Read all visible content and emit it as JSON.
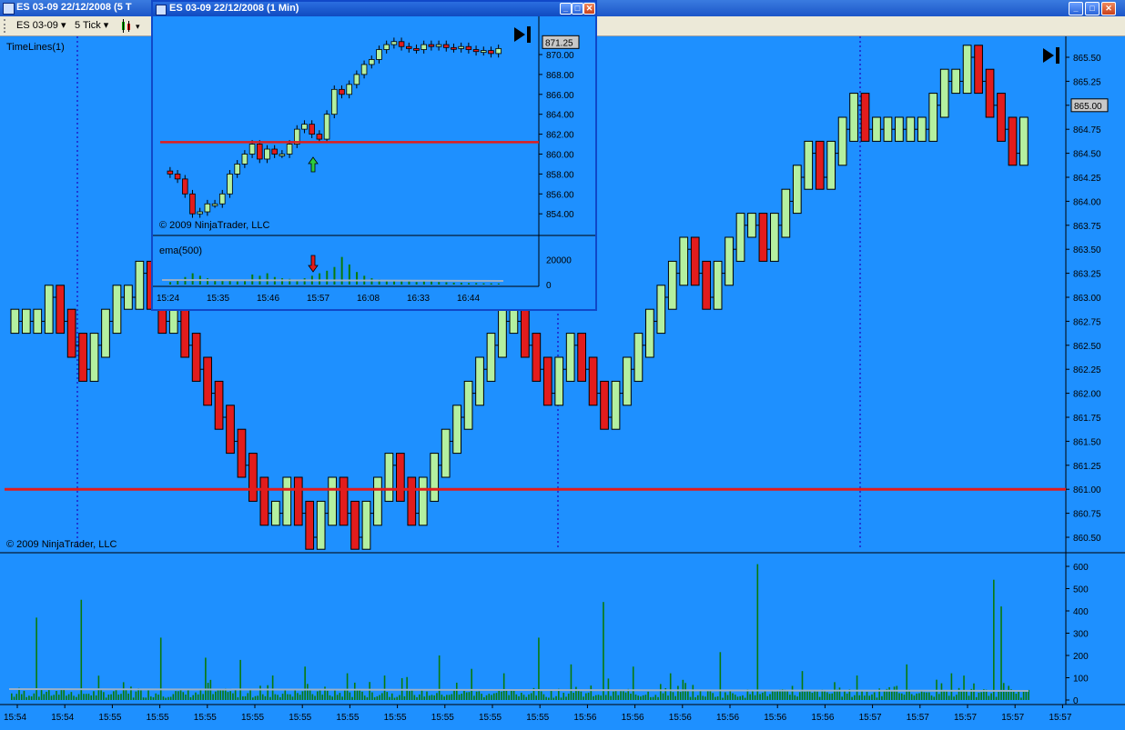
{
  "main_window": {
    "title": "ES 03-09  22/12/2008 (5 T"
  },
  "toolbar": {
    "instrument": "ES 03-09",
    "interval": "5 Tick"
  },
  "main_chart": {
    "indicator_label": "TimeLines(1)",
    "copyright": "© 2009 NinjaTrader, LLC",
    "current_price": "865.00",
    "price_ticks": [
      "865.50",
      "865.25",
      "865.00",
      "864.75",
      "864.50",
      "864.25",
      "864.00",
      "863.75",
      "863.50",
      "863.25",
      "863.00",
      "862.75",
      "862.50",
      "862.25",
      "862.00",
      "861.75",
      "861.50",
      "861.25",
      "861.00",
      "860.75",
      "860.50"
    ],
    "volume_ticks": [
      "600",
      "500",
      "400",
      "300",
      "200",
      "100",
      "0"
    ],
    "time_labels": [
      "15:54",
      "15:54",
      "15:55",
      "15:55",
      "15:55",
      "15:55",
      "15:55",
      "15:55",
      "15:55",
      "15:55",
      "15:55",
      "15:55",
      "15:56",
      "15:56",
      "15:56",
      "15:56",
      "15:56",
      "15:56",
      "15:57",
      "15:57",
      "15:57",
      "15:57",
      "15:57"
    ],
    "colors": {
      "background": "#1e90ff",
      "up_bar": "#b4f0a0",
      "down_bar": "#e21c1c",
      "level_line": "#e21c1c",
      "volume": "#0a7a0a",
      "timeline": "#1e1ec8"
    }
  },
  "popup_window": {
    "title": "ES 03-09  22/12/2008 (1 Min)",
    "copyright": "© 2009 NinjaTrader, LLC",
    "indicator_label": "ema(500)",
    "current_price": "871.25",
    "price_ticks": [
      "870.00",
      "868.00",
      "866.00",
      "864.00",
      "862.00",
      "860.00",
      "858.00",
      "856.00",
      "854.00"
    ],
    "volume_ticks": [
      "20000",
      "0"
    ],
    "time_labels": [
      "15:24",
      "15:35",
      "15:46",
      "15:57",
      "16:08",
      "16:33",
      "16:44"
    ]
  },
  "icons": {
    "skip_to_end": "skip-end-icon"
  }
}
